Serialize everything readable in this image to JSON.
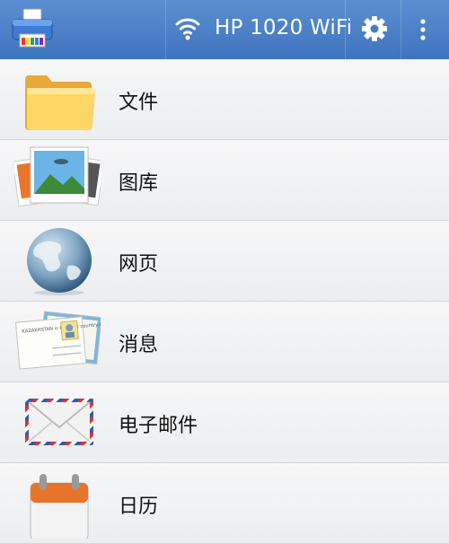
{
  "header": {
    "printer_name": "HP 1020 WiFi",
    "icons": [
      "app-printer-icon",
      "wifi-icon",
      "settings-gear-icon",
      "overflow-menu-icon"
    ],
    "accent_color": "#4a7fc7"
  },
  "menu": {
    "items": [
      {
        "label": "文件",
        "icon": "folder-icon"
      },
      {
        "label": "图库",
        "icon": "photo-gallery-icon"
      },
      {
        "label": "网页",
        "icon": "globe-icon"
      },
      {
        "label": "消息",
        "icon": "postcard-icon"
      },
      {
        "label": "电子邮件",
        "icon": "envelope-icon"
      },
      {
        "label": "日历",
        "icon": "calendar-icon"
      }
    ],
    "postcard_text": "KAZAKHSTAN is the best country in the world"
  }
}
